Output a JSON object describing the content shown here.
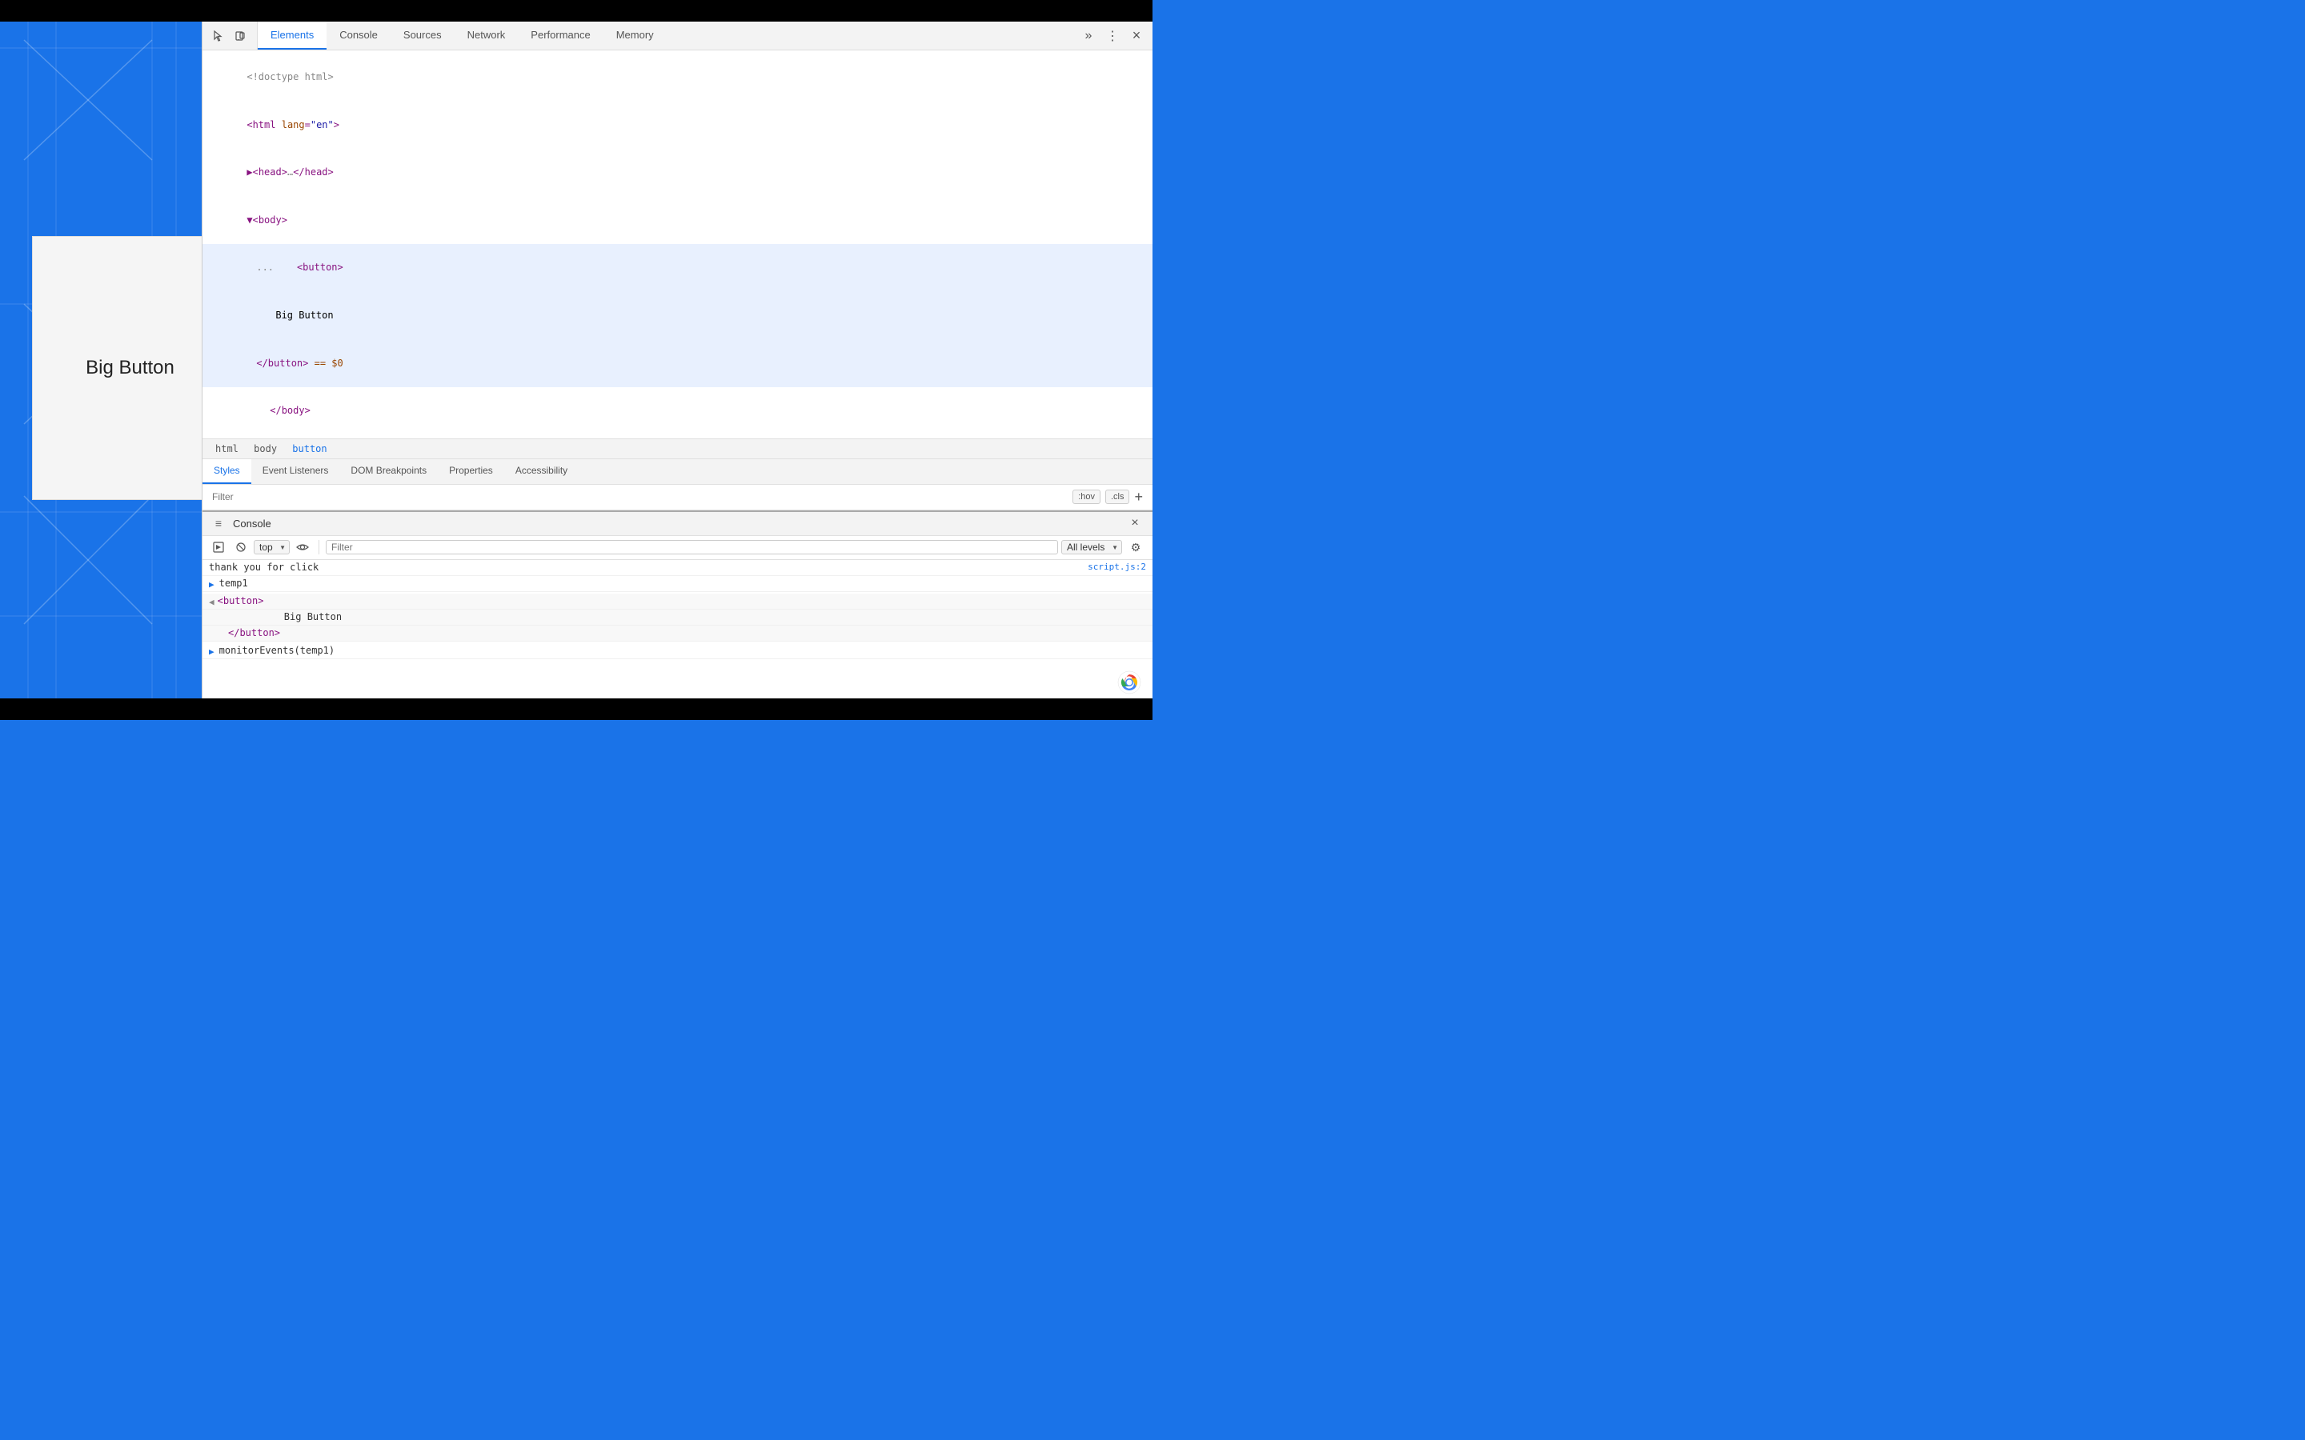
{
  "topBar": {},
  "bottomBar": {},
  "webpage": {
    "bigButton": "Big Button"
  },
  "devtools": {
    "tabs": [
      {
        "label": "Elements",
        "active": true
      },
      {
        "label": "Console",
        "active": false
      },
      {
        "label": "Sources",
        "active": false
      },
      {
        "label": "Network",
        "active": false
      },
      {
        "label": "Performance",
        "active": false
      },
      {
        "label": "Memory",
        "active": false
      }
    ],
    "moreTabsLabel": "»",
    "menuLabel": "⋮",
    "closeLabel": "×",
    "htmlTree": {
      "line1": "<!doctype html>",
      "line2": "<html lang=\"en\">",
      "line3": "▶<head>…</head>",
      "line4": "▼<body>",
      "line5": "...",
      "line6": "<button>",
      "line7": "Big Button",
      "line8": "</button> == $0",
      "line9": "</body>"
    },
    "breadcrumb": {
      "items": [
        "html",
        "body",
        "button"
      ]
    },
    "panelTabs": [
      {
        "label": "Styles",
        "active": true
      },
      {
        "label": "Event Listeners",
        "active": false
      },
      {
        "label": "DOM Breakpoints",
        "active": false
      },
      {
        "label": "Properties",
        "active": false
      },
      {
        "label": "Accessibility",
        "active": false
      }
    ],
    "filterBar": {
      "placeholder": "Filter",
      "hov": ":hov",
      "cls": ".cls",
      "plus": "+"
    },
    "console": {
      "title": "Console",
      "dragIcon": "≡",
      "closeLabel": "×",
      "toolbar": {
        "context": "top",
        "filterPlaceholder": "Filter",
        "levels": "All levels"
      },
      "output": [
        {
          "type": "log",
          "text": "thank you for click",
          "location": "script.js:2"
        },
        {
          "type": "expand",
          "arrow": "▶",
          "text": "temp1"
        },
        {
          "type": "output",
          "arrow": "◀",
          "lines": [
            "<button>",
            "    Big Button",
            "</button>"
          ]
        },
        {
          "type": "command",
          "arrow": "▶",
          "text": "monitorEvents(temp1)"
        }
      ]
    }
  }
}
